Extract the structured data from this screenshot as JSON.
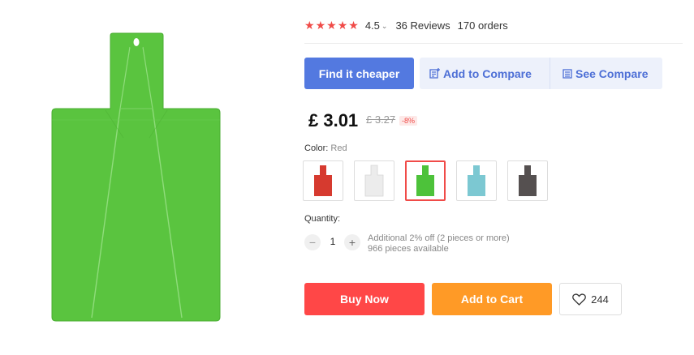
{
  "product": {
    "rating_value": "4.5",
    "reviews": "36 Reviews",
    "orders": "170 orders",
    "stars_filled": 5
  },
  "actions": {
    "find_cheaper": "Find it cheaper",
    "add_to_compare": "Add to Compare",
    "see_compare": "See Compare"
  },
  "pricing": {
    "price": "£ 3.01",
    "old_price": "£ 3.27",
    "discount": "-8%"
  },
  "color": {
    "label": "Color:",
    "selected": "Red",
    "swatches": [
      {
        "name": "red",
        "fill": "#d63a2f"
      },
      {
        "name": "white",
        "fill": "#ececec"
      },
      {
        "name": "green",
        "fill": "#4dc23a"
      },
      {
        "name": "blue",
        "fill": "#7cc8d2"
      },
      {
        "name": "gray",
        "fill": "#555050"
      }
    ],
    "selected_index": 2
  },
  "quantity": {
    "label": "Quantity:",
    "value": "1",
    "note_line1": "Additional 2% off (2 pieces or more)",
    "note_line2": "966 pieces available"
  },
  "purchase": {
    "buy_now": "Buy Now",
    "add_to_cart": "Add to Cart",
    "wishlist_count": "244"
  },
  "colors": {
    "accent_red": "#ff4747",
    "accent_orange": "#ff9a26",
    "accent_blue": "#5379e0",
    "star": "#f04b48"
  }
}
